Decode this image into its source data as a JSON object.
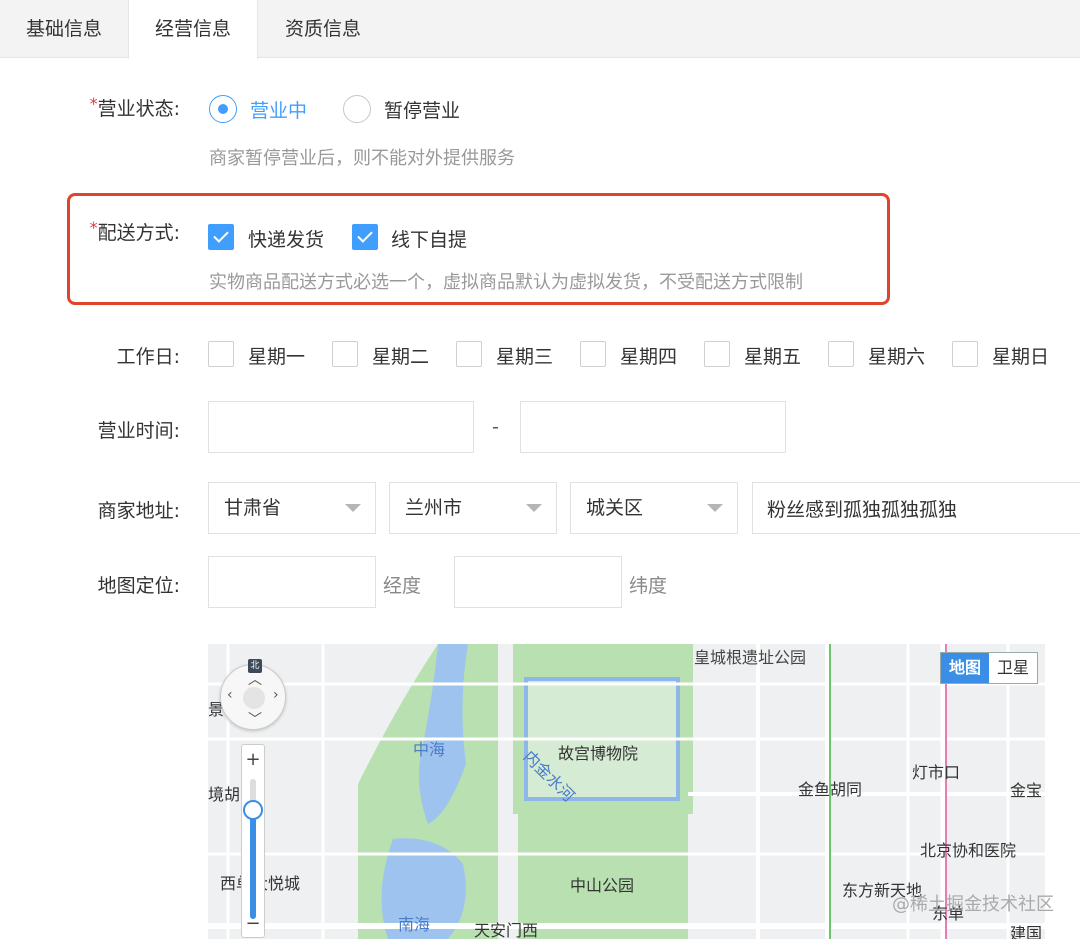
{
  "tabs": [
    "基础信息",
    "经营信息",
    "资质信息"
  ],
  "status": {
    "label": "营业状态:",
    "options": [
      "营业中",
      "暂停营业"
    ],
    "selected": "营业中",
    "hint": "商家暂停营业后，则不能对外提供服务"
  },
  "delivery": {
    "label": "配送方式:",
    "options": [
      "快递发货",
      "线下自提"
    ],
    "checked": [
      true,
      true
    ],
    "hint": "实物商品配送方式必选一个，虚拟商品默认为虚拟发货，不受配送方式限制"
  },
  "workdays": {
    "label": "工作日:",
    "days": [
      "星期一",
      "星期二",
      "星期三",
      "星期四",
      "星期五",
      "星期六",
      "星期日"
    ]
  },
  "hours": {
    "label": "营业时间:",
    "separator": "-"
  },
  "address": {
    "label": "商家地址:",
    "province": "甘肃省",
    "city": "兰州市",
    "district": "城关区",
    "detail": "粉丝感到孤独孤独孤独"
  },
  "location": {
    "label": "地图定位:",
    "lng_unit": "经度",
    "lat_unit": "纬度"
  },
  "map": {
    "type_options": [
      "地图",
      "卫星"
    ],
    "north": "北",
    "labels": {
      "imperial_wall_park": "皇城根遗址公园",
      "zhonghai": "中海",
      "palace_museum": "故宫博物院",
      "inner_river": "内金水河",
      "dengshikou": "灯市口",
      "jinyu_hutong": "金鱼胡同",
      "jinbao": "金宝",
      "pumc_hospital": "北京协和医院",
      "zhongshan_park": "中山公园",
      "xi_huan_yue": "西单大悦城",
      "dongfang_xintiandi": "东方新天地",
      "nanhai": "南海",
      "tiananmen_west": "天安门西",
      "dongdan": "东单",
      "jianguo": "建国",
      "left_edge_1": "景",
      "left_edge_2": "境胡"
    }
  },
  "watermark": "@稀土掘金技术社区",
  "colors": {
    "accent": "#409eff",
    "required": "#e4393c",
    "highlight_box": "#e0442e"
  }
}
